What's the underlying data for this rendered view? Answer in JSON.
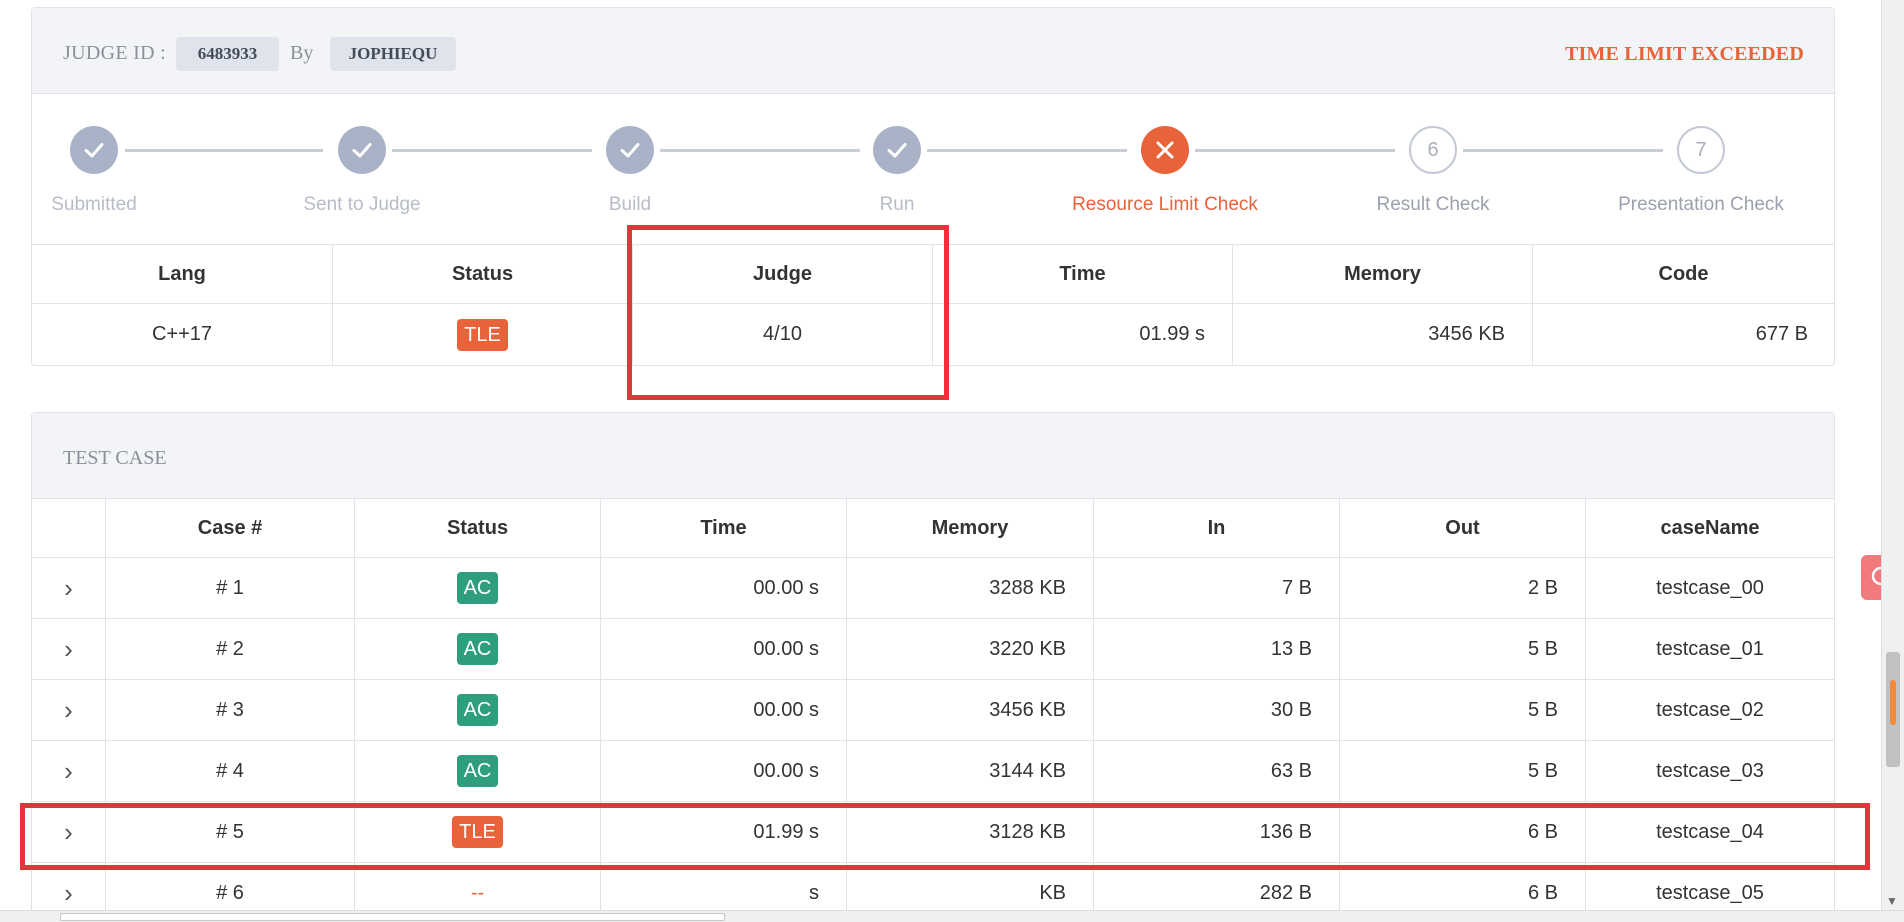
{
  "header": {
    "judge_id_label": "JUDGE ID :",
    "judge_id": "6483933",
    "by_label": "By",
    "user": "JOPHIEQU",
    "verdict": "TIME LIMIT EXCEEDED"
  },
  "steps": [
    {
      "label": "Submitted",
      "state": "done",
      "icon": "check-icon"
    },
    {
      "label": "Sent to Judge",
      "state": "done",
      "icon": "check-icon"
    },
    {
      "label": "Build",
      "state": "done",
      "icon": "check-icon"
    },
    {
      "label": "Run",
      "state": "done",
      "icon": "check-icon"
    },
    {
      "label": "Resource Limit Check",
      "state": "fail",
      "icon": "x-icon"
    },
    {
      "label": "Result Check",
      "state": "todo",
      "number": "6"
    },
    {
      "label": "Presentation Check",
      "state": "todo",
      "number": "7"
    }
  ],
  "judge_table": {
    "headers": [
      "Lang",
      "Status",
      "Judge",
      "Time",
      "Memory",
      "Code"
    ],
    "row": {
      "lang": "C++17",
      "status": "TLE",
      "judge": "4/10",
      "time": "01.99 s",
      "memory": "3456 KB",
      "code": "677 B"
    }
  },
  "test_case": {
    "title": "TEST CASE",
    "headers": [
      "",
      "Case #",
      "Status",
      "Time",
      "Memory",
      "In",
      "Out",
      "caseName"
    ],
    "rows": [
      {
        "case": "# 1",
        "status": "AC",
        "time": "00.00 s",
        "memory": "3288 KB",
        "in": "7 B",
        "out": "2 B",
        "name": "testcase_00"
      },
      {
        "case": "# 2",
        "status": "AC",
        "time": "00.00 s",
        "memory": "3220 KB",
        "in": "13 B",
        "out": "5 B",
        "name": "testcase_01"
      },
      {
        "case": "# 3",
        "status": "AC",
        "time": "00.00 s",
        "memory": "3456 KB",
        "in": "30 B",
        "out": "5 B",
        "name": "testcase_02"
      },
      {
        "case": "# 4",
        "status": "AC",
        "time": "00.00 s",
        "memory": "3144 KB",
        "in": "63 B",
        "out": "5 B",
        "name": "testcase_03"
      },
      {
        "case": "# 5",
        "status": "TLE",
        "time": "01.99 s",
        "memory": "3128 KB",
        "in": "136 B",
        "out": "6 B",
        "name": "testcase_04"
      },
      {
        "case": "# 6",
        "status": "--",
        "time": "s",
        "memory": "KB",
        "in": "282 B",
        "out": "6 B",
        "name": "testcase_05"
      }
    ]
  },
  "colors": {
    "accent": "#e8623a",
    "ac": "#2f9e7e",
    "highlight": "#e8323c"
  }
}
